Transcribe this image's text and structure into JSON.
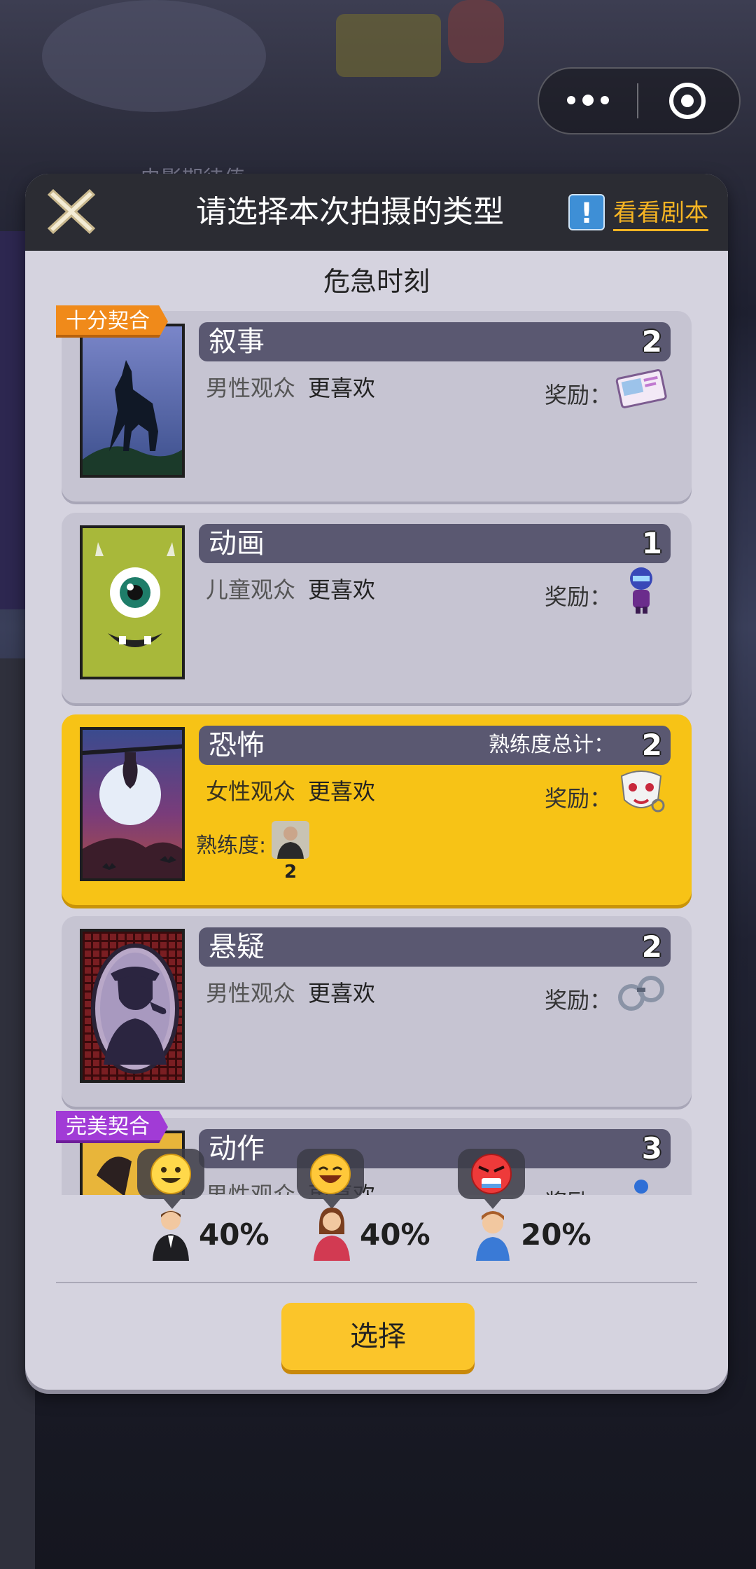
{
  "header": {
    "title": "请选择本次拍摄的类型",
    "script_link": "看看剧本",
    "script_icon_glyph": "!",
    "behind_text": "电影期待值"
  },
  "subtitle": "危急时刻",
  "genres": [
    {
      "name": "叙事",
      "count": "2",
      "audience": "男性观众",
      "preference": "更喜欢",
      "reward_label": "奖励：",
      "tag": "十分契合",
      "reward_icon": "photo-ticket-icon",
      "selected": false
    },
    {
      "name": "动画",
      "count": "1",
      "audience": "儿童观众",
      "preference": "更喜欢",
      "reward_label": "奖励：",
      "tag": "",
      "reward_icon": "purple-figure-icon",
      "selected": false
    },
    {
      "name": "恐怖",
      "count": "2",
      "audience": "女性观众",
      "preference": "更喜欢",
      "reward_label": "奖励：",
      "tag": "",
      "reward_icon": "clown-mask-icon",
      "selected": true,
      "proficiency_total_label": "熟练度总计：",
      "proficiency_label": "熟练度:",
      "proficiency_count": "2"
    },
    {
      "name": "悬疑",
      "count": "2",
      "audience": "男性观众",
      "preference": "更喜欢",
      "reward_label": "奖励：",
      "tag": "",
      "reward_icon": "handcuffs-icon",
      "selected": false
    },
    {
      "name": "动作",
      "count": "3",
      "audience": "男性观众",
      "preference": "更喜欢",
      "reward_label": "奖励：",
      "tag": "完美契合",
      "reward_icon": "blue-figure-icon",
      "selected": false
    }
  ],
  "audience_split": [
    {
      "label": "40%",
      "value": 40,
      "type": "male",
      "reaction": "happy-face-icon"
    },
    {
      "label": "40%",
      "value": 40,
      "type": "female",
      "reaction": "laughing-face-icon"
    },
    {
      "label": "20%",
      "value": 20,
      "type": "child",
      "reaction": "angry-face-icon"
    }
  ],
  "select_button": "选择",
  "colors": {
    "selected_card": "#f7c316",
    "card": "#c6c4d2",
    "tag_orange": "#f08a1a",
    "tag_purple": "#a13bd6",
    "accent_link": "#f5b423",
    "header_bg": "#2b2c33"
  }
}
